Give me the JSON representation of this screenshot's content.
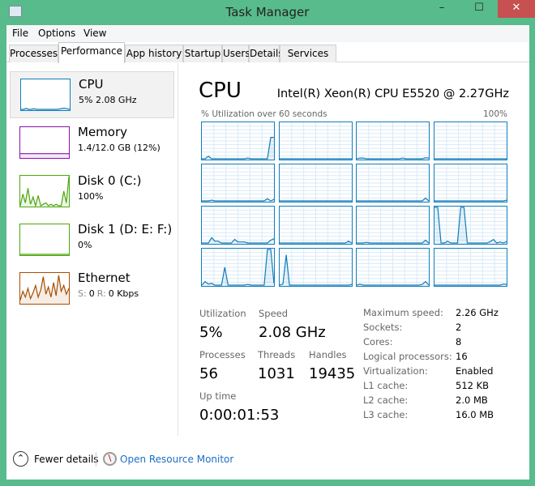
{
  "window": {
    "title": "Task Manager",
    "minimize": "–",
    "maximize": "☐",
    "close": "✕"
  },
  "menu": [
    "File",
    "Options",
    "View"
  ],
  "tabs": [
    "Processes",
    "Performance",
    "App history",
    "Startup",
    "Users",
    "Details",
    "Services"
  ],
  "active_tab": "Performance",
  "sidebar": [
    {
      "title": "CPU",
      "sub": "5% 2.08 GHz",
      "color": "#117dbb",
      "series": [
        0,
        0,
        3,
        0,
        0,
        2,
        0,
        0,
        0,
        0,
        0,
        0,
        0,
        0,
        0,
        1,
        3,
        4,
        2,
        0
      ]
    },
    {
      "title": "Memory",
      "sub": "1.4/12.0 GB (12%)",
      "color": "#8b12ae",
      "series": [
        12,
        12,
        12,
        12,
        12,
        12,
        12,
        12,
        12,
        12,
        12,
        12,
        12,
        12,
        12,
        12,
        12,
        12,
        12,
        12
      ]
    },
    {
      "title": "Disk 0 (C:)",
      "sub": "100%",
      "color": "#4da60c",
      "series": [
        0,
        40,
        10,
        60,
        5,
        30,
        0,
        35,
        0,
        5,
        10,
        0,
        5,
        0,
        5,
        0,
        0,
        50,
        10,
        100
      ]
    },
    {
      "title": "Disk 1 (D: E: F:)",
      "sub": "0%",
      "color": "#4da60c",
      "series": [
        0,
        0,
        0,
        0,
        0,
        0,
        0,
        0,
        0,
        0,
        0,
        0,
        0,
        0,
        0,
        0,
        0,
        0,
        0,
        0
      ]
    },
    {
      "title": "Ethernet",
      "sub_s_label": "S:",
      "sub_s": "0",
      "sub_r_label": "R:",
      "sub_r": "0 Kbps",
      "color": "#a74f01",
      "series": [
        10,
        40,
        20,
        50,
        15,
        35,
        60,
        20,
        45,
        90,
        30,
        55,
        20,
        70,
        25,
        95,
        40,
        60,
        30,
        50
      ]
    }
  ],
  "main": {
    "title": "CPU",
    "model": "Intel(R) Xeon(R) CPU E5520 @ 2.27GHz",
    "graph_label": "% Utilization over 60 seconds",
    "graph_max": "100%",
    "accent": "#117dbb",
    "cores": [
      [
        0,
        0,
        7,
        0,
        0,
        0,
        0,
        0,
        0,
        0,
        0,
        0,
        0,
        0,
        2,
        0,
        0,
        0,
        0,
        0,
        0,
        60,
        60
      ],
      [
        0,
        0,
        0,
        0,
        0,
        0,
        0,
        0,
        0,
        0,
        0,
        0,
        0,
        0,
        0,
        0,
        0,
        0,
        0,
        0,
        0,
        0,
        0
      ],
      [
        0,
        2,
        2,
        0,
        0,
        0,
        0,
        0,
        0,
        0,
        0,
        0,
        0,
        0,
        2,
        0,
        0,
        0,
        0,
        0,
        0,
        3,
        2
      ],
      [
        0,
        0,
        0,
        0,
        0,
        0,
        0,
        0,
        0,
        0,
        0,
        0,
        0,
        0,
        0,
        0,
        0,
        0,
        0,
        0,
        0,
        0,
        0
      ],
      [
        0,
        0,
        0,
        2,
        0,
        0,
        0,
        0,
        0,
        0,
        0,
        0,
        0,
        0,
        0,
        0,
        0,
        0,
        0,
        0,
        6,
        0,
        4
      ],
      [
        0,
        0,
        0,
        0,
        0,
        0,
        0,
        0,
        0,
        0,
        0,
        0,
        0,
        0,
        0,
        0,
        0,
        0,
        0,
        0,
        0,
        0,
        0
      ],
      [
        0,
        0,
        0,
        0,
        0,
        0,
        0,
        0,
        0,
        0,
        0,
        0,
        0,
        0,
        0,
        0,
        0,
        0,
        0,
        0,
        0,
        8,
        0
      ],
      [
        0,
        0,
        0,
        0,
        0,
        0,
        0,
        0,
        0,
        0,
        0,
        0,
        0,
        0,
        0,
        0,
        0,
        0,
        0,
        0,
        0,
        0,
        2
      ],
      [
        0,
        0,
        0,
        15,
        5,
        5,
        0,
        0,
        0,
        0,
        10,
        3,
        3,
        3,
        0,
        0,
        0,
        0,
        0,
        0,
        0,
        8,
        12
      ],
      [
        0,
        0,
        0,
        0,
        0,
        0,
        0,
        0,
        0,
        0,
        0,
        0,
        0,
        0,
        0,
        0,
        0,
        0,
        0,
        0,
        0,
        5,
        0
      ],
      [
        0,
        0,
        0,
        2,
        0,
        0,
        0,
        0,
        0,
        0,
        0,
        0,
        0,
        0,
        0,
        0,
        0,
        0,
        0,
        0,
        0,
        8,
        0
      ],
      [
        100,
        100,
        0,
        0,
        5,
        0,
        0,
        0,
        100,
        100,
        0,
        0,
        0,
        0,
        0,
        0,
        0,
        4,
        10,
        0,
        3,
        0,
        4
      ],
      [
        0,
        10,
        3,
        5,
        0,
        0,
        0,
        50,
        0,
        0,
        0,
        0,
        0,
        0,
        2,
        0,
        0,
        0,
        0,
        0,
        100,
        100,
        5
      ],
      [
        0,
        3,
        85,
        0,
        0,
        0,
        0,
        0,
        0,
        0,
        0,
        0,
        0,
        0,
        0,
        0,
        0,
        0,
        0,
        0,
        0,
        0,
        2
      ],
      [
        0,
        3,
        0,
        0,
        0,
        0,
        0,
        0,
        0,
        0,
        0,
        0,
        0,
        0,
        0,
        0,
        0,
        0,
        0,
        0,
        2,
        10,
        0
      ],
      [
        0,
        0,
        0,
        0,
        0,
        0,
        0,
        0,
        0,
        0,
        0,
        0,
        0,
        0,
        0,
        0,
        0,
        0,
        0,
        0,
        0,
        3,
        2
      ]
    ],
    "stats": {
      "utilization_label": "Utilization",
      "utilization": "5%",
      "speed_label": "Speed",
      "speed": "2.08 GHz",
      "processes_label": "Processes",
      "processes": "56",
      "threads_label": "Threads",
      "threads": "1031",
      "handles_label": "Handles",
      "handles": "19435",
      "uptime_label": "Up time",
      "uptime": "0:00:01:53"
    },
    "info": [
      [
        "Maximum speed:",
        "2.26 GHz"
      ],
      [
        "Sockets:",
        "2"
      ],
      [
        "Cores:",
        "8"
      ],
      [
        "Logical processors:",
        "16"
      ],
      [
        "Virtualization:",
        "Enabled"
      ],
      [
        "L1 cache:",
        "512 KB"
      ],
      [
        "L2 cache:",
        "2.0 MB"
      ],
      [
        "L3 cache:",
        "16.0 MB"
      ]
    ]
  },
  "footer": {
    "fewer_details": "Fewer details",
    "resource_monitor": "Open Resource Monitor",
    "link_color": "#1a6fc7"
  }
}
